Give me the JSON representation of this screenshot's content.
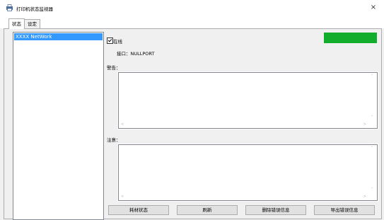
{
  "window": {
    "title": "打印机状态监视器",
    "close_glyph": "×"
  },
  "tabs": [
    {
      "label": "状态"
    },
    {
      "label": "设定"
    }
  ],
  "printers": [
    {
      "name": "XXXX NetWork"
    }
  ],
  "status": {
    "online_label": "在线",
    "online_checked": true,
    "port_text": "接口：NULLPORT",
    "indicator_color": "#12ad2b"
  },
  "warning": {
    "label": "警告：",
    "content": ""
  },
  "note": {
    "label": "注意：",
    "content": ""
  },
  "buttons": {
    "consumables": "耗材状态",
    "refresh": "刷新",
    "delete_errors": "删除错误信息",
    "export_errors": "导出错误信息"
  }
}
